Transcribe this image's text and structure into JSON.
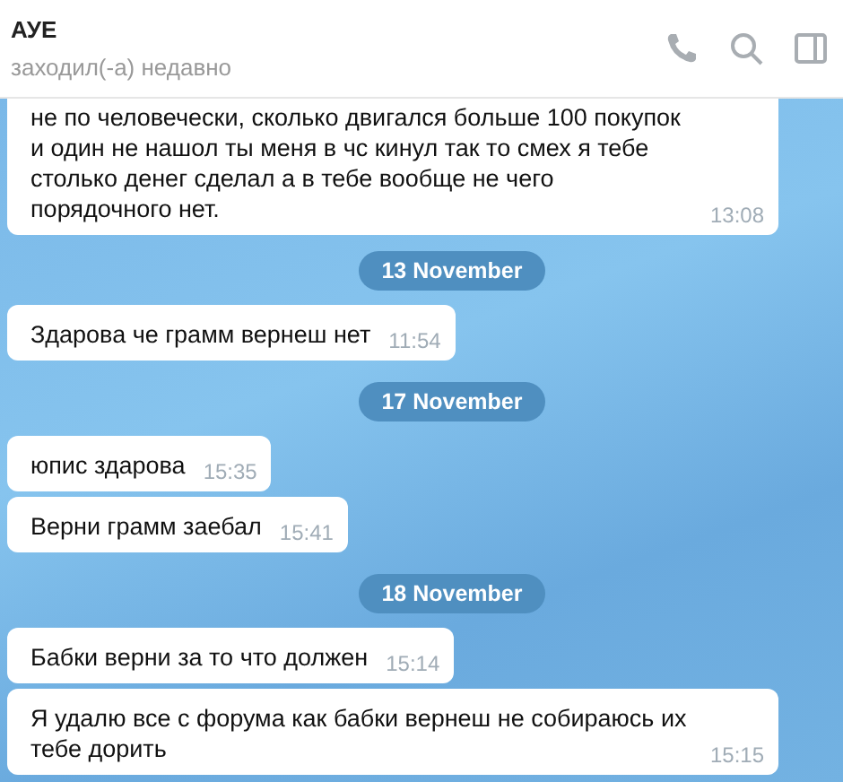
{
  "header": {
    "title": "АУЕ",
    "status": "заходил(-а) недавно"
  },
  "messages": [
    {
      "kind": "message",
      "text": "не по человечески, сколько двигался больше 100 покупок и один не нашол ты меня в чс кинул так то смех я тебе столько денег сделал а в тебе вообще не чего порядочного нет.",
      "time": "13:08"
    },
    {
      "kind": "date",
      "text": "13 November"
    },
    {
      "kind": "message",
      "text": "Здарова че грамм вернеш нет",
      "time": "11:54"
    },
    {
      "kind": "date",
      "text": "17 November"
    },
    {
      "kind": "message",
      "text": "юпис здарова",
      "time": "15:35"
    },
    {
      "kind": "message",
      "text": "Верни грамм заебал",
      "time": "15:41"
    },
    {
      "kind": "date",
      "text": "18 November"
    },
    {
      "kind": "message",
      "text": "Бабки верни за то что должен",
      "time": "15:14"
    },
    {
      "kind": "message",
      "text": "Я удалю все с форума как бабки вернеш не собираюсь их тебе дорить",
      "time": "15:15"
    }
  ]
}
